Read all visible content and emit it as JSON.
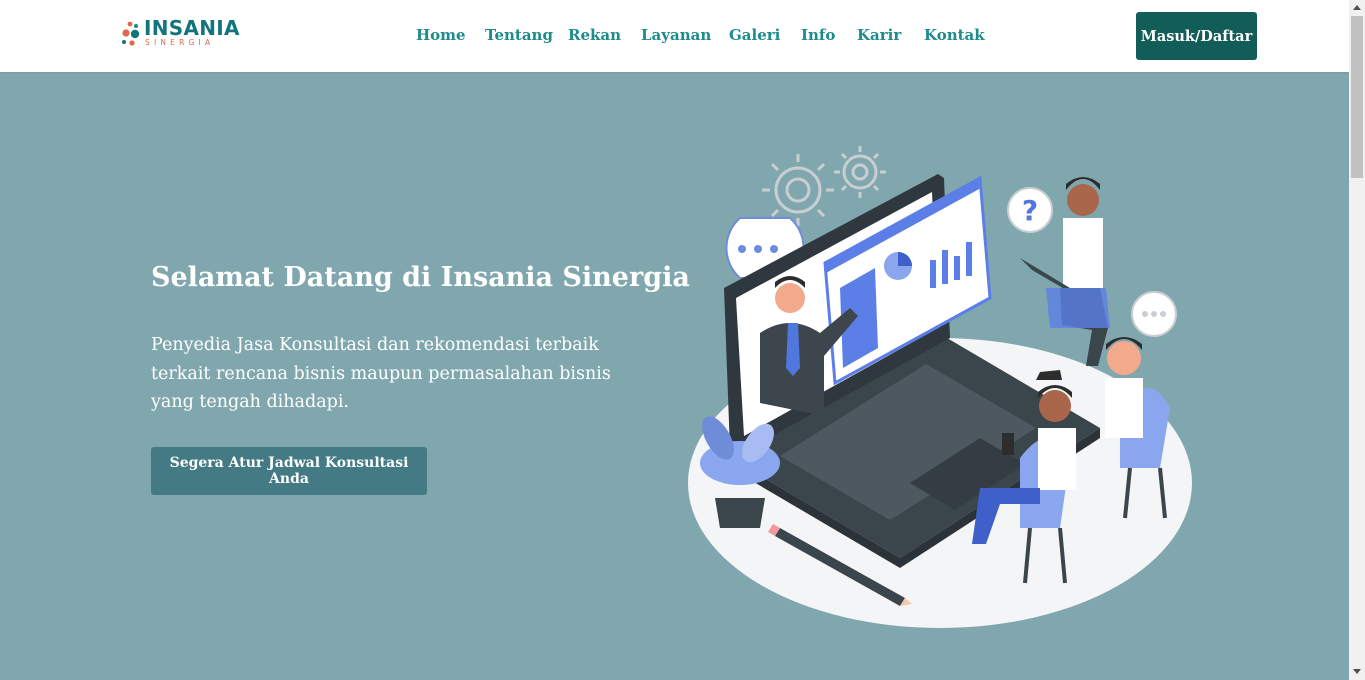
{
  "brand": {
    "name": "INSANIA",
    "tagline": "SINERGIA",
    "primary_color": "#13757b",
    "accent_color": "#e0684b"
  },
  "nav": {
    "items": [
      {
        "label": "Home"
      },
      {
        "label": "Tentang"
      },
      {
        "label": "Rekan"
      },
      {
        "label": "Layanan"
      },
      {
        "label": "Galeri"
      },
      {
        "label": "Info"
      },
      {
        "label": "Karir"
      },
      {
        "label": "Kontak"
      }
    ],
    "login_label": "Masuk/Daftar"
  },
  "hero": {
    "title": "Selamat Datang di Insania Sinergia",
    "description": "Penyedia Jasa Konsultasi dan rekomendasi terbaik terkait rencana bisnis maupun permasalahan bisnis yang tengah dihadapi.",
    "cta_label": "Segera Atur Jadwal Konsultasi Anda",
    "background_color": "#80a7ae",
    "illustration_icon": "online-consultation-illustration"
  },
  "colors": {
    "login_button": "#135d58",
    "cta_button": "#437a83",
    "nav_link": "#1d8c8a"
  }
}
